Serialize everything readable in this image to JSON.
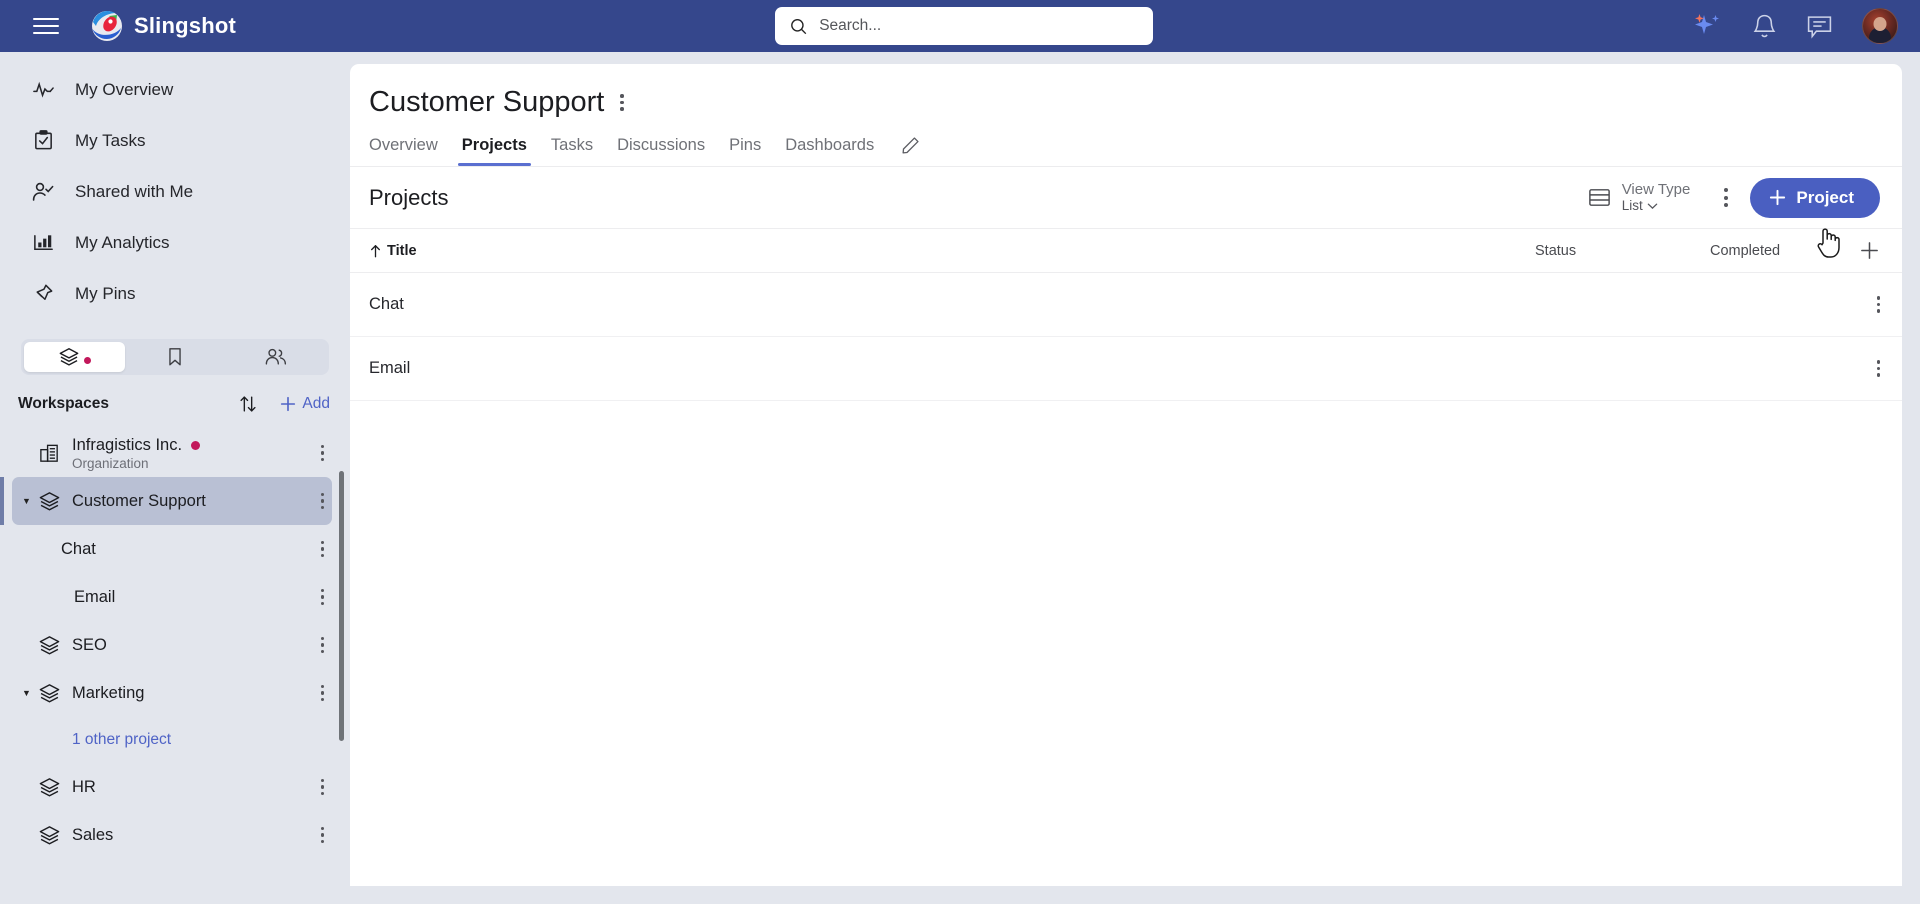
{
  "topbar": {
    "menu_icon": "hamburger-icon",
    "brand": "Slingshot",
    "search": {
      "placeholder": "Search...",
      "value": "",
      "icon": "search-icon"
    },
    "actions": [
      {
        "name": "ai-sparkle-icon",
        "label": "AI Assistant"
      },
      {
        "name": "notifications-bell-icon",
        "label": "Notifications"
      },
      {
        "name": "chat-message-icon",
        "label": "Messages"
      },
      {
        "name": "avatar",
        "label": "User profile"
      }
    ],
    "bg_color": "#35478c"
  },
  "sidebar": {
    "nav_items": [
      {
        "label": "My Overview",
        "icon": "activity-pulse-icon"
      },
      {
        "label": "My Tasks",
        "icon": "clipboard-check-icon"
      },
      {
        "label": "Shared with Me",
        "icon": "person-check-icon"
      },
      {
        "label": "My Analytics",
        "icon": "bar-chart-icon"
      },
      {
        "label": "My Pins",
        "icon": "pin-icon"
      }
    ],
    "segment_tabs": [
      {
        "name": "workspaces-tab",
        "icon": "layers-icon",
        "active": true,
        "badge": true
      },
      {
        "name": "bookmarks-tab",
        "icon": "bookmark-icon",
        "active": false,
        "badge": false
      },
      {
        "name": "people-tab",
        "icon": "people-icon",
        "active": false,
        "badge": false
      }
    ],
    "workspaces_header": {
      "title": "Workspaces",
      "sort_icon": "sort-arrows-icon",
      "add_label": "Add",
      "add_icon": "plus-icon"
    },
    "tree": [
      {
        "label": "Infragistics Inc.",
        "sublabel": "Organization",
        "icon": "building-icon",
        "level": 0,
        "dot": true,
        "selected": false,
        "caret": ""
      },
      {
        "label": "Customer Support",
        "sublabel": "",
        "icon": "layers-icon",
        "level": 0,
        "dot": false,
        "selected": true,
        "caret": "expanded"
      },
      {
        "label": "Chat",
        "sublabel": "",
        "icon": "",
        "level": 1,
        "dot": false,
        "selected": false,
        "caret": ""
      },
      {
        "label": "Email",
        "sublabel": "",
        "icon": "",
        "level": 2,
        "dot": false,
        "selected": false,
        "caret": ""
      },
      {
        "label": "SEO",
        "sublabel": "",
        "icon": "layers-icon",
        "level": 0,
        "dot": false,
        "selected": false,
        "caret": ""
      },
      {
        "label": "Marketing",
        "sublabel": "",
        "icon": "layers-icon",
        "level": 0,
        "dot": false,
        "selected": false,
        "caret": "expanded"
      }
    ],
    "other_project_link": "1 other project",
    "tree_after": [
      {
        "label": "HR",
        "sublabel": "",
        "icon": "layers-icon",
        "level": 0,
        "dot": false,
        "selected": false,
        "caret": ""
      },
      {
        "label": "Sales",
        "sublabel": "",
        "icon": "layers-icon",
        "level": 0,
        "dot": false,
        "selected": false,
        "caret": ""
      }
    ],
    "accent_color": "#4f63c6",
    "badge_color": "#c2185b"
  },
  "page": {
    "title": "Customer Support",
    "title_menu_icon": "kebab-menu-icon",
    "tabs": [
      {
        "label": "Overview",
        "active": false
      },
      {
        "label": "Projects",
        "active": true
      },
      {
        "label": "Tasks",
        "active": false
      },
      {
        "label": "Discussions",
        "active": false
      },
      {
        "label": "Pins",
        "active": false
      },
      {
        "label": "Dashboards",
        "active": false
      }
    ],
    "tabs_edit_icon": "pencil-edit-icon",
    "active_tab_color": "#5a6fd0"
  },
  "panel": {
    "title": "Projects",
    "view_type": {
      "icon": "list-view-icon",
      "label": "View Type",
      "value": "List",
      "chevron": "chevron-down-icon"
    },
    "more_icon": "kebab-menu-icon",
    "add_button": {
      "label": "Project",
      "icon": "plus-icon",
      "color": "#4a5fc1"
    },
    "columns": [
      {
        "key": "title",
        "label": "Title",
        "sort": "asc",
        "sort_icon": "arrow-up-icon"
      },
      {
        "key": "status",
        "label": "Status",
        "sort": ""
      },
      {
        "key": "completed",
        "label": "Completed",
        "sort": ""
      }
    ],
    "add_column_icon": "plus-icon",
    "rows": [
      {
        "title": "Chat",
        "status": "",
        "completed": "",
        "menu_icon": "kebab-menu-icon"
      },
      {
        "title": "Email",
        "status": "",
        "completed": "",
        "menu_icon": "kebab-menu-icon"
      }
    ]
  },
  "cursor": {
    "type": "pointing-hand"
  }
}
